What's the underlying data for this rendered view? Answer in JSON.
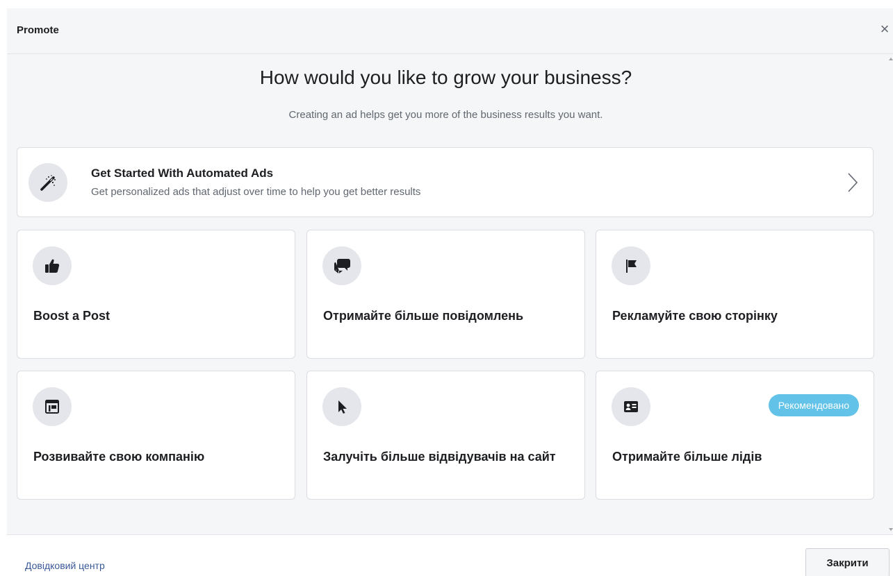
{
  "modal": {
    "title": "Promote",
    "close_symbol": "×"
  },
  "body": {
    "heading": "How would you like to grow your business?",
    "subheading": "Creating an ad helps get you more of the business results you want."
  },
  "automated_ads": {
    "title": "Get Started With Automated Ads",
    "description": "Get personalized ads that adjust over time to help you get better results",
    "icon": "magic-wand-icon"
  },
  "options": [
    {
      "label": "Boost a Post",
      "icon": "thumbs-up-icon"
    },
    {
      "label": "Отримайте більше повідомлень",
      "icon": "chat-bubbles-icon"
    },
    {
      "label": "Рекламуйте свою сторінку",
      "icon": "flag-icon"
    },
    {
      "label": "Розвивайте свою компанію",
      "icon": "storefront-icon"
    },
    {
      "label": "Залучіть більше відвідувачів на сайт",
      "icon": "cursor-icon"
    },
    {
      "label": "Отримайте більше лідів",
      "icon": "contact-card-icon",
      "badge": "Рекомендовано"
    }
  ],
  "footer": {
    "help_link": "Довідковий центр",
    "close_button": "Закрити"
  },
  "colors": {
    "badge": "#62c2e8",
    "link": "#385898",
    "panel_bg": "#f5f6f7",
    "icon_circle": "#e4e6eb"
  }
}
